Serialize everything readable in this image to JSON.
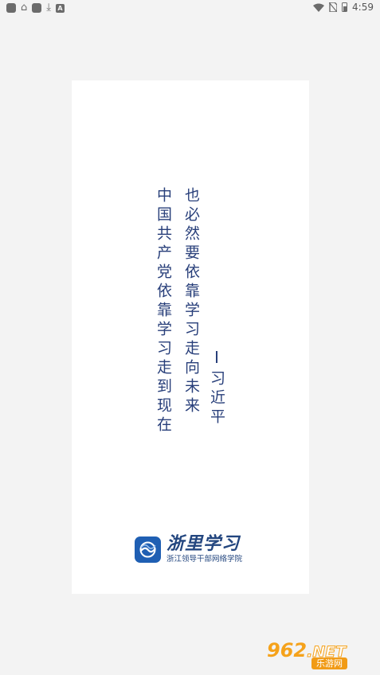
{
  "status_bar": {
    "left_icons": [
      "notification-square-icon",
      "app-icon",
      "notification-square-icon",
      "download-icon",
      "a-icon"
    ],
    "time": "4:59"
  },
  "quote": {
    "col1": "中国共产党依靠学习走到现在",
    "col2": "也必然要依靠学习走向未来",
    "author": "习近平"
  },
  "logo": {
    "title": "浙里学习",
    "subtitle": "浙江领导干部网络学院"
  },
  "watermark": {
    "main": "962",
    "net": ".NET",
    "sub": "乐游网"
  },
  "colors": {
    "background": "#f3f3f3",
    "card": "#ffffff",
    "quote_text": "#283f7a",
    "logo_blue": "#1f5fb3",
    "watermark_orange": "#f5a21b"
  }
}
